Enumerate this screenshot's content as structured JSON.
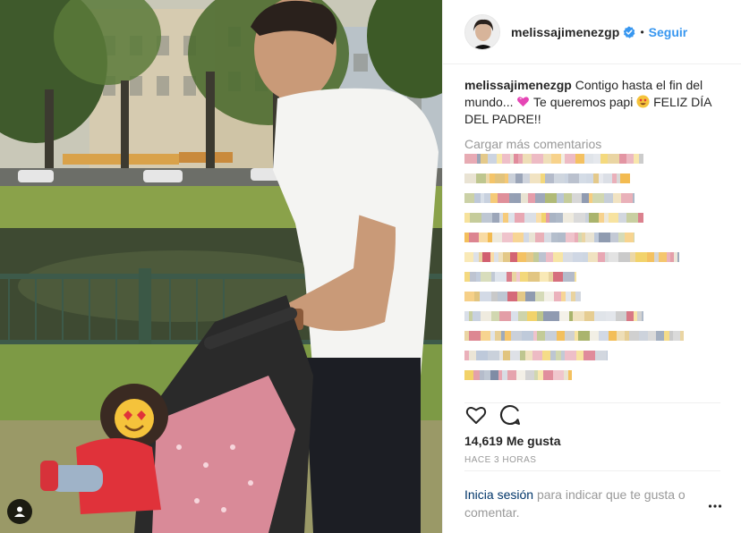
{
  "post": {
    "author": "melissajimenezgp",
    "follow_label": "Seguir",
    "separator": "•",
    "caption_author": "melissajimenezgp",
    "caption_text_1": "Contigo hasta el fin del mundo...",
    "caption_text_2": "Te queremos papi",
    "caption_text_3": "FELIZ DÍA DEL PADRE!!",
    "load_more_label": "Cargar más comentarios",
    "likes_count": "14,619",
    "likes_label": "Me gusta",
    "timestamp": "HACE 3 HORAS",
    "login_link": "Inicia sesión",
    "login_text": "para indicar que te gusta o comentar."
  },
  "icons": {
    "verified": "verified-badge-icon",
    "like": "heart-icon",
    "comment": "comment-bubble-icon",
    "more": "more-options-icon",
    "tag": "user-tag-icon"
  },
  "colors": {
    "accent": "#3897f0",
    "text": "#262626",
    "muted": "#999999",
    "link_dark": "#003569",
    "divider": "#efefef"
  }
}
